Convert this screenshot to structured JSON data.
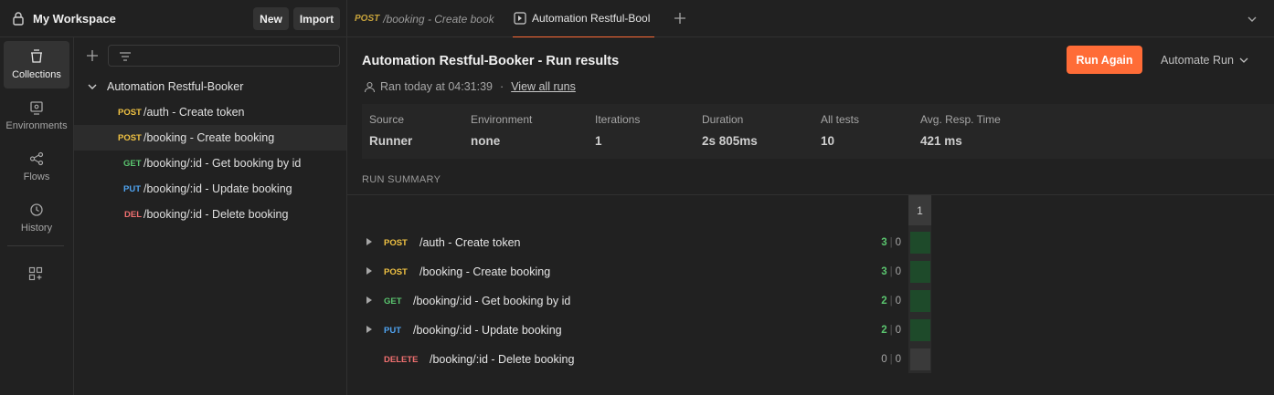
{
  "workspace": {
    "title": "My Workspace",
    "new_label": "New",
    "import_label": "Import"
  },
  "tabs": [
    {
      "method": "POST",
      "label": "/booking - Create book"
    },
    {
      "label": "Automation Restful-Bool"
    }
  ],
  "rail": [
    {
      "label": "Collections",
      "icon": "collections-icon",
      "active": true
    },
    {
      "label": "Environments",
      "icon": "environments-icon"
    },
    {
      "label": "Flows",
      "icon": "flows-icon"
    },
    {
      "label": "History",
      "icon": "history-icon"
    }
  ],
  "sidebar": {
    "collection": "Automation Restful-Booker",
    "items": [
      {
        "method": "POST",
        "label": "/auth - Create token"
      },
      {
        "method": "POST",
        "label": "/booking - Create booking"
      },
      {
        "method": "GET",
        "label": "/booking/:id - Get booking by id"
      },
      {
        "method": "PUT",
        "label": "/booking/:id - Update booking"
      },
      {
        "method": "DEL",
        "label": "/booking/:id - Delete booking"
      }
    ]
  },
  "run": {
    "title": "Automation Restful-Booker - Run results",
    "ran": "Ran today at 04:31:39",
    "dot": "·",
    "view_all": "View all runs",
    "run_again": "Run Again",
    "automate": "Automate Run"
  },
  "stats": [
    {
      "label": "Source",
      "value": "Runner"
    },
    {
      "label": "Environment",
      "value": "none"
    },
    {
      "label": "Iterations",
      "value": "1"
    },
    {
      "label": "Duration",
      "value": "2s 805ms"
    },
    {
      "label": "All tests",
      "value": "10"
    },
    {
      "label": "Avg. Resp. Time",
      "value": "421 ms"
    }
  ],
  "summary": {
    "label": "RUN SUMMARY",
    "iteration_header": "1",
    "rows": [
      {
        "method": "POST",
        "path": "/auth - Create token",
        "passed": "3",
        "failed": "0"
      },
      {
        "method": "POST",
        "path": "/booking - Create booking",
        "passed": "3",
        "failed": "0"
      },
      {
        "method": "GET",
        "path": "/booking/:id - Get booking by id",
        "passed": "2",
        "failed": "0"
      },
      {
        "method": "PUT",
        "path": "/booking/:id - Update booking",
        "passed": "2",
        "failed": "0"
      },
      {
        "method": "DELETE",
        "path": "/booking/:id - Delete booking",
        "passed": "0",
        "failed": "0"
      }
    ]
  },
  "colors": {
    "accent": "#ff6c37",
    "post": "#f0c243",
    "get": "#5ac46e",
    "put": "#4fa3f0",
    "delete": "#f07070",
    "pass": "#1e4a2a"
  }
}
